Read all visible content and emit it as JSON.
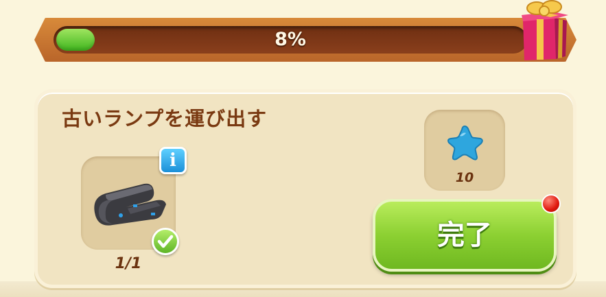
{
  "progress": {
    "percent_label": "8%",
    "value": 0.08
  },
  "quest": {
    "title": "古いランプを運び出す",
    "item": {
      "icon": "old-lamp-icon",
      "count": "1/1",
      "completed": true
    },
    "reward": {
      "icon": "blue-star-icon",
      "amount": "10"
    },
    "complete_button_label": "完了"
  },
  "colors": {
    "progress_green": "#4cc02a",
    "button_green": "#8cd032",
    "title_brown": "#7a3a12",
    "notification_red": "#e0180e"
  }
}
